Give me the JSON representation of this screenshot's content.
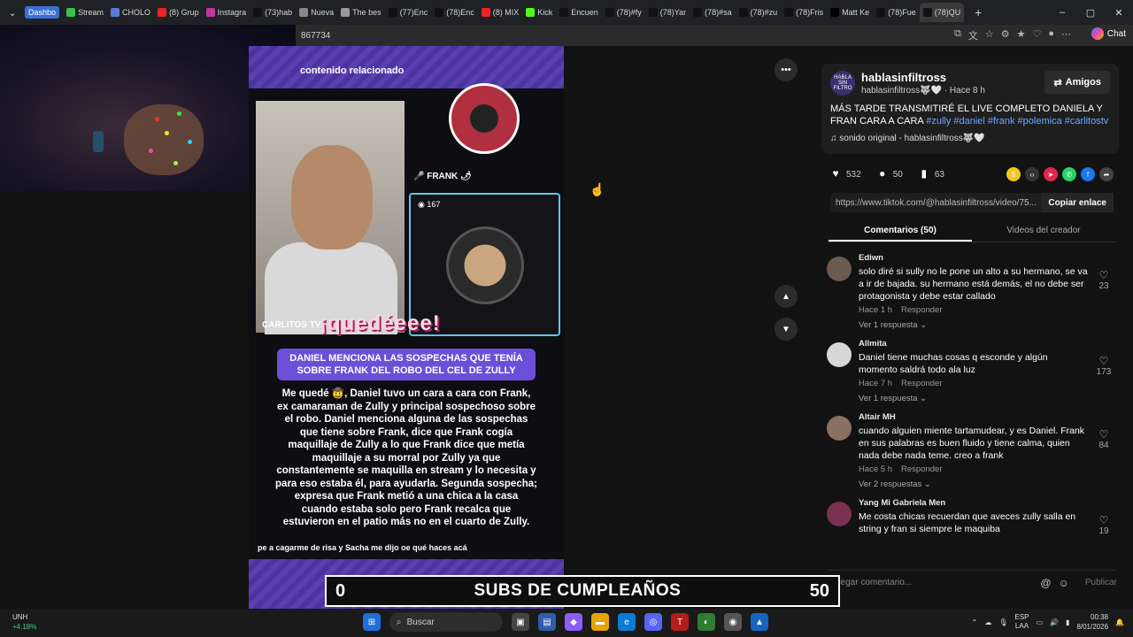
{
  "tabs": [
    {
      "label": "Dashbo",
      "color": "#3b6fd6",
      "dash": true
    },
    {
      "label": "Stream",
      "color": "#39c24a"
    },
    {
      "label": "CHOLO",
      "color": "#5a7ad6"
    },
    {
      "label": "(8) Grup",
      "color": "#e22"
    },
    {
      "label": "Instagra",
      "color": "#c3359b"
    },
    {
      "label": "(73)hab",
      "color": "#111"
    },
    {
      "label": "Nueva",
      "color": "#888"
    },
    {
      "label": "The bes",
      "color": "#999"
    },
    {
      "label": "(77)Enc",
      "color": "#111"
    },
    {
      "label": "(78)Enc",
      "color": "#111"
    },
    {
      "label": "(8) MIX",
      "color": "#e22"
    },
    {
      "label": "Kick",
      "color": "#53fc18"
    },
    {
      "label": "Encuen",
      "color": "#111"
    },
    {
      "label": "(78)#fy",
      "color": "#111"
    },
    {
      "label": "(78)Yar",
      "color": "#111"
    },
    {
      "label": "(78)#sa",
      "color": "#111"
    },
    {
      "label": "(78)#zu",
      "color": "#111"
    },
    {
      "label": "(78)Fris",
      "color": "#111"
    },
    {
      "label": "Matt Ke",
      "color": "#000"
    },
    {
      "label": "(78)Fue",
      "color": "#111"
    },
    {
      "label": "(78)QU",
      "color": "#111",
      "active": true
    }
  ],
  "address": {
    "url_tail": "867734"
  },
  "chat_label": "Chat",
  "video": {
    "related_label": "contenido relacionado",
    "carlitos_label": "CARLITOS TV",
    "frank_label": "🎤 FRANK 🌶",
    "viewer_count": "167",
    "quedeee": "¡quedéeee!",
    "headline": "DANIEL MENCIONA LAS SOSPECHAS QUE TENÍA SOBRE FRANK DEL ROBO DEL CEL DE ZULLY",
    "body": "Me quedé 🤠, Daniel tuvo un cara a cara con Frank, ex camaraman de Zully y principal sospechoso sobre el robo. Daniel menciona alguna de las sospechas que tiene sobre Frank, dice que Frank cogía maquillaje de Zully a lo que Frank dice que metía maquillaje a su morral por Zully ya que constantemente se maquilla en stream y lo necesita y para eso estaba él, para ayudarla. Segunda sospecha; expresa que Frank metió a una chica a la casa cuando estaba solo pero Frank recalca que estuvieron en el patio más no en el cuarto de Zully.",
    "caption2": "pe a cagarme de risa y Sacha me dijo oe qué haces acá"
  },
  "creator": {
    "name": "hablasinfiltross",
    "avatar_text": "HABLA SIN FILTRO",
    "sub": "hablasinfiltross🐺🤍 · Hace 8 h",
    "follow_label": "Amigos",
    "desc_text": "MÁS TARDE TRANSMITIRÉ EL LIVE COMPLETO DANIELA Y FRAN CARA A CARA ",
    "hashtags": "#zully #daniel #frank #polemica #carlitostv",
    "sound": "♫  sonido original - hablasinfiltross🐺🤍"
  },
  "stats": {
    "likes": "532",
    "comments": "50",
    "saves": "63"
  },
  "share_colors": [
    "#f5c518",
    "#333",
    "#e2264d",
    "#25d366",
    "#1877f2",
    "#444"
  ],
  "url_row": {
    "url": "https://www.tiktok.com/@hablasinfiltross/video/75...",
    "copy_label": "Copiar enlace"
  },
  "panel_tabs": {
    "comments": "Comentarios (50)",
    "creator_videos": "Videos del creador"
  },
  "comments": [
    {
      "user": "Ediwn",
      "text": "solo diré si sully no le pone un alto a su hermano, se va a ir de bajada. su hermano está demás, el no debe ser protagonista y debe estar callado",
      "time": "Hace 1 h",
      "reply": "Responder",
      "replies": "Ver 1 respuesta ⌄",
      "likes": "23",
      "avatar": "#6a5a50"
    },
    {
      "user": "Allmita",
      "text": "Daniel tiene muchas cosas q esconde y algún momento saldrá todo ala luz",
      "time": "Hace 7 h",
      "reply": "Responder",
      "replies": "Ver 1 respuesta ⌄",
      "likes": "173",
      "avatar": "#d8d8d8"
    },
    {
      "user": "Altair MH",
      "text": "cuando alguien miente tartamudear, y es Daniel. Frank en sus palabras es buen fluido y tiene calma, quien nada debe nada teme. creo a frank",
      "time": "Hace 5 h",
      "reply": "Responder",
      "replies": "Ver 2 respuestas ⌄",
      "likes": "84",
      "avatar": "#8a7060"
    },
    {
      "user": "Yang Mi Gabriela Men",
      "text": "Me costa chicas recuerdan que aveces zully salla en string y fran si siempre le maquiba",
      "time": "",
      "reply": "",
      "replies": "",
      "likes": "19",
      "avatar": "#7a3050"
    }
  ],
  "add_comment": {
    "placeholder": "Agregar comentario...",
    "publish": "Publicar"
  },
  "banner": {
    "left_num": "0",
    "label": "SUBS DE CUMPLEAÑOS",
    "right_num": "50"
  },
  "taskbar": {
    "ticker_symbol": "UNH",
    "ticker_change": "+4.18%",
    "search": "Buscar",
    "lang": "ESP\nLAA",
    "time": "00:38",
    "date": "8/01/2026"
  }
}
